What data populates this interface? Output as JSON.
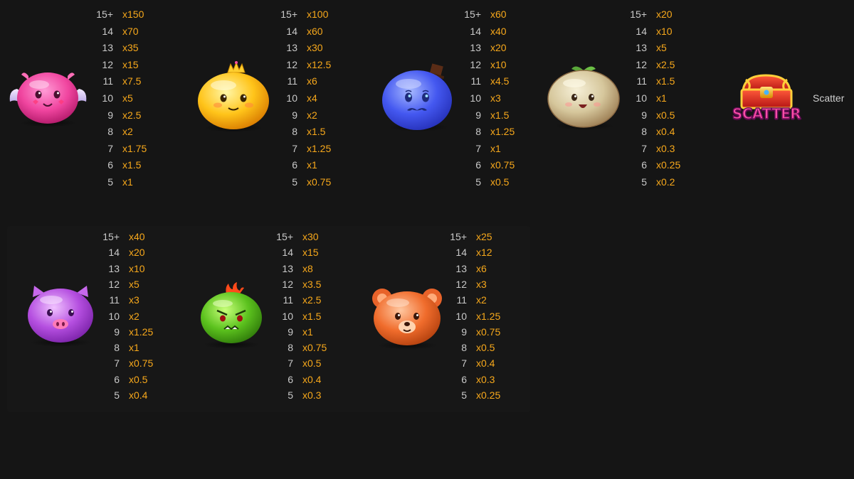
{
  "paytable": {
    "symbols": [
      {
        "id": "pink-bat-blob",
        "rows": [
          {
            "count": "15+",
            "multiplier": "x150"
          },
          {
            "count": "14",
            "multiplier": "x70"
          },
          {
            "count": "13",
            "multiplier": "x35"
          },
          {
            "count": "12",
            "multiplier": "x15"
          },
          {
            "count": "11",
            "multiplier": "x7.5"
          },
          {
            "count": "10",
            "multiplier": "x5"
          },
          {
            "count": "9",
            "multiplier": "x2.5"
          },
          {
            "count": "8",
            "multiplier": "x2"
          },
          {
            "count": "7",
            "multiplier": "x1.75"
          },
          {
            "count": "6",
            "multiplier": "x1.5"
          },
          {
            "count": "5",
            "multiplier": "x1"
          }
        ]
      },
      {
        "id": "yellow-crown-blob",
        "rows": [
          {
            "count": "15+",
            "multiplier": "x100"
          },
          {
            "count": "14",
            "multiplier": "x60"
          },
          {
            "count": "13",
            "multiplier": "x30"
          },
          {
            "count": "12",
            "multiplier": "x12.5"
          },
          {
            "count": "11",
            "multiplier": "x6"
          },
          {
            "count": "10",
            "multiplier": "x4"
          },
          {
            "count": "9",
            "multiplier": "x2"
          },
          {
            "count": "8",
            "multiplier": "x1.5"
          },
          {
            "count": "7",
            "multiplier": "x1.25"
          },
          {
            "count": "6",
            "multiplier": "x1"
          },
          {
            "count": "5",
            "multiplier": "x0.75"
          }
        ]
      },
      {
        "id": "blue-tophat-blob",
        "rows": [
          {
            "count": "15+",
            "multiplier": "x60"
          },
          {
            "count": "14",
            "multiplier": "x40"
          },
          {
            "count": "13",
            "multiplier": "x20"
          },
          {
            "count": "12",
            "multiplier": "x10"
          },
          {
            "count": "11",
            "multiplier": "x4.5"
          },
          {
            "count": "10",
            "multiplier": "x3"
          },
          {
            "count": "9",
            "multiplier": "x1.5"
          },
          {
            "count": "8",
            "multiplier": "x1.25"
          },
          {
            "count": "7",
            "multiplier": "x1"
          },
          {
            "count": "6",
            "multiplier": "x0.75"
          },
          {
            "count": "5",
            "multiplier": "x0.5"
          }
        ]
      },
      {
        "id": "beige-sprout-blob",
        "rows": [
          {
            "count": "15+",
            "multiplier": "x20"
          },
          {
            "count": "14",
            "multiplier": "x10"
          },
          {
            "count": "13",
            "multiplier": "x5"
          },
          {
            "count": "12",
            "multiplier": "x2.5"
          },
          {
            "count": "11",
            "multiplier": "x1.5"
          },
          {
            "count": "10",
            "multiplier": "x1"
          },
          {
            "count": "9",
            "multiplier": "x0.5"
          },
          {
            "count": "8",
            "multiplier": "x0.4"
          },
          {
            "count": "7",
            "multiplier": "x0.3"
          },
          {
            "count": "6",
            "multiplier": "x0.25"
          },
          {
            "count": "5",
            "multiplier": "x0.2"
          }
        ]
      },
      {
        "id": "purple-pig-blob",
        "rows": [
          {
            "count": "15+",
            "multiplier": "x40"
          },
          {
            "count": "14",
            "multiplier": "x20"
          },
          {
            "count": "13",
            "multiplier": "x10"
          },
          {
            "count": "12",
            "multiplier": "x5"
          },
          {
            "count": "11",
            "multiplier": "x3"
          },
          {
            "count": "10",
            "multiplier": "x2"
          },
          {
            "count": "9",
            "multiplier": "x1.25"
          },
          {
            "count": "8",
            "multiplier": "x1"
          },
          {
            "count": "7",
            "multiplier": "x0.75"
          },
          {
            "count": "6",
            "multiplier": "x0.5"
          },
          {
            "count": "5",
            "multiplier": "x0.4"
          }
        ]
      },
      {
        "id": "green-flame-blob",
        "rows": [
          {
            "count": "15+",
            "multiplier": "x30"
          },
          {
            "count": "14",
            "multiplier": "x15"
          },
          {
            "count": "13",
            "multiplier": "x8"
          },
          {
            "count": "12",
            "multiplier": "x3.5"
          },
          {
            "count": "11",
            "multiplier": "x2.5"
          },
          {
            "count": "10",
            "multiplier": "x1.5"
          },
          {
            "count": "9",
            "multiplier": "x1"
          },
          {
            "count": "8",
            "multiplier": "x0.75"
          },
          {
            "count": "7",
            "multiplier": "x0.5"
          },
          {
            "count": "6",
            "multiplier": "x0.4"
          },
          {
            "count": "5",
            "multiplier": "x0.3"
          }
        ]
      },
      {
        "id": "orange-bear-blob",
        "rows": [
          {
            "count": "15+",
            "multiplier": "x25"
          },
          {
            "count": "14",
            "multiplier": "x12"
          },
          {
            "count": "13",
            "multiplier": "x6"
          },
          {
            "count": "12",
            "multiplier": "x3"
          },
          {
            "count": "11",
            "multiplier": "x2"
          },
          {
            "count": "10",
            "multiplier": "x1.25"
          },
          {
            "count": "9",
            "multiplier": "x0.75"
          },
          {
            "count": "8",
            "multiplier": "x0.5"
          },
          {
            "count": "7",
            "multiplier": "x0.4"
          },
          {
            "count": "6",
            "multiplier": "x0.3"
          },
          {
            "count": "5",
            "multiplier": "x0.25"
          }
        ]
      }
    ],
    "scatter": {
      "label": "Scatter",
      "logo_text": "SCATTER"
    }
  },
  "colors": {
    "background": "#151515",
    "count_text": "#c9c9c9",
    "multiplier_text": "#f7a81b",
    "scatter_label": "#cfcfcf"
  }
}
